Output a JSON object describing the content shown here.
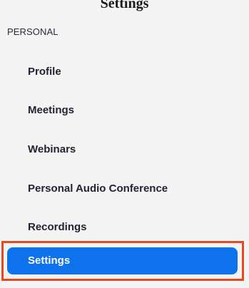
{
  "top_partial_text": "Settings",
  "sidebar": {
    "section_label": "PERSONAL",
    "items": [
      {
        "label": "Profile",
        "active": false
      },
      {
        "label": "Meetings",
        "active": false
      },
      {
        "label": "Webinars",
        "active": false
      },
      {
        "label": "Personal Audio Conference",
        "active": false
      },
      {
        "label": "Recordings",
        "active": false
      },
      {
        "label": "Settings",
        "active": true
      }
    ]
  },
  "colors": {
    "sidebar_background": "#f4f4f5",
    "active_item_background": "#0e72ed",
    "active_item_text": "#ffffff",
    "item_text": "#232333",
    "annotation_outline": "#e8481e"
  }
}
